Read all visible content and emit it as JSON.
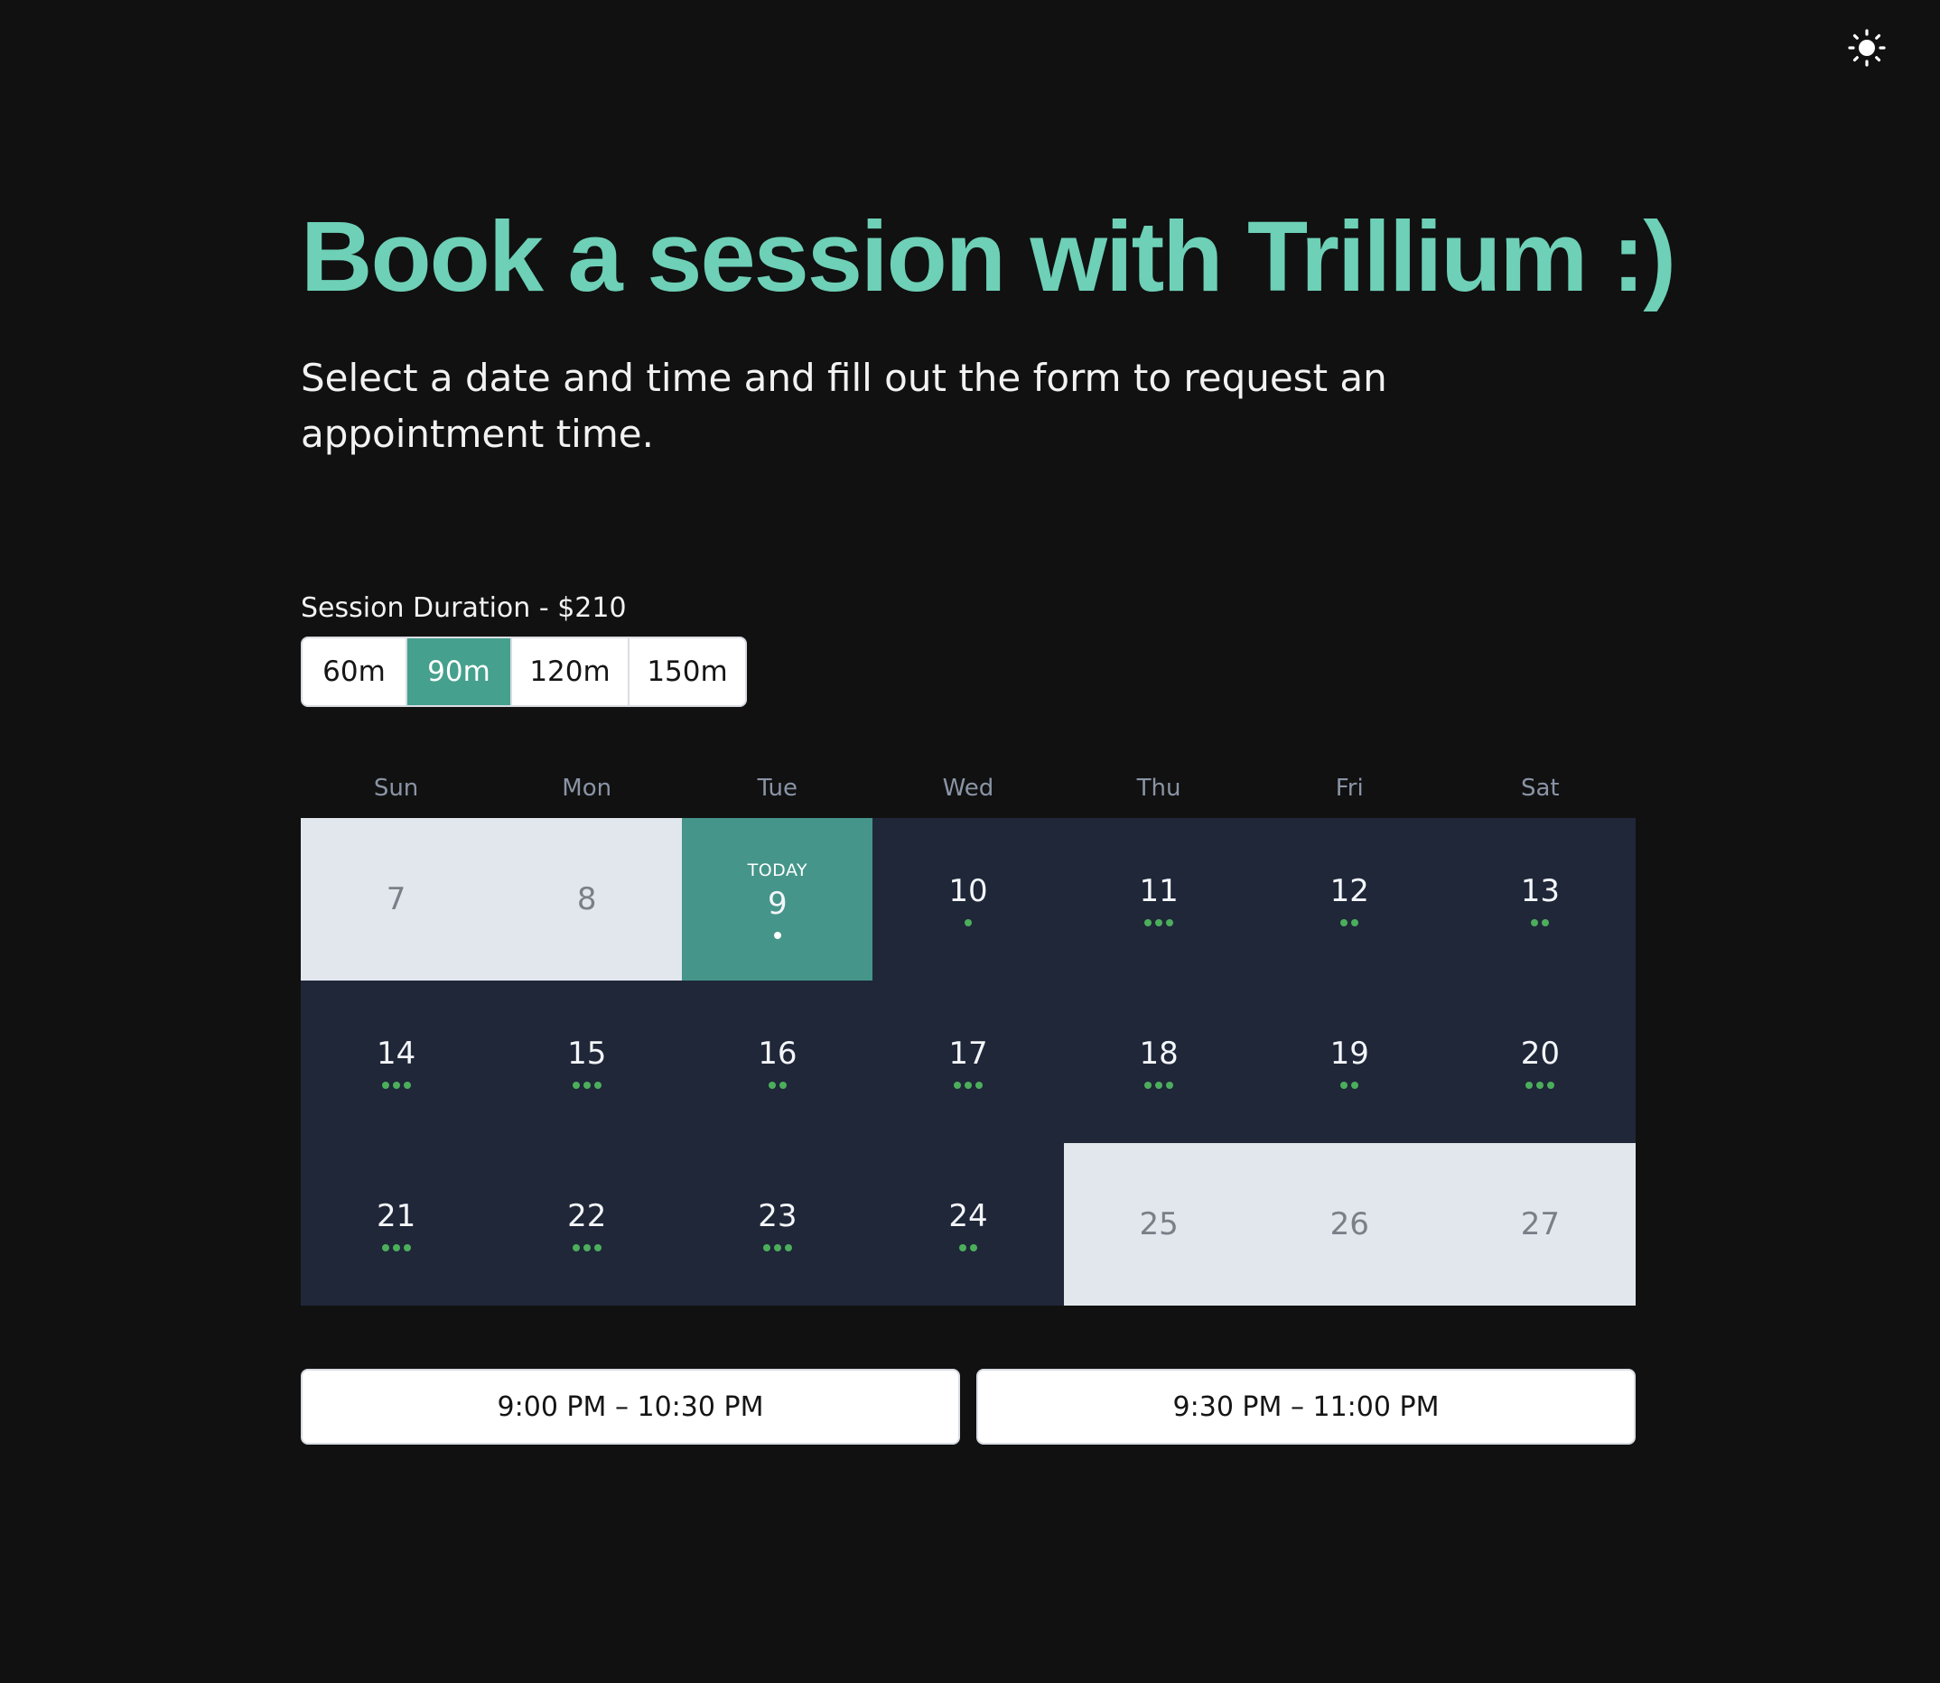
{
  "header": {
    "theme_toggle_icon": "sun-icon"
  },
  "hero": {
    "title": "Book a session with Trillium :)",
    "subtitle": "Select a date and time and fill out the form to request an appointment time."
  },
  "duration": {
    "label": "Session Duration - $210",
    "options": [
      "60m",
      "90m",
      "120m",
      "150m"
    ],
    "selected": "90m"
  },
  "calendar": {
    "weekdays": [
      "Sun",
      "Mon",
      "Tue",
      "Wed",
      "Thu",
      "Fri",
      "Sat"
    ],
    "today_label": "TODAY",
    "days": [
      {
        "num": "7",
        "state": "disabled",
        "slots": 0
      },
      {
        "num": "8",
        "state": "disabled",
        "slots": 0
      },
      {
        "num": "9",
        "state": "today",
        "slots": 1
      },
      {
        "num": "10",
        "state": "available",
        "slots": 1
      },
      {
        "num": "11",
        "state": "available",
        "slots": 3
      },
      {
        "num": "12",
        "state": "available",
        "slots": 2
      },
      {
        "num": "13",
        "state": "available",
        "slots": 2
      },
      {
        "num": "14",
        "state": "available",
        "slots": 3
      },
      {
        "num": "15",
        "state": "available",
        "slots": 3
      },
      {
        "num": "16",
        "state": "available",
        "slots": 2
      },
      {
        "num": "17",
        "state": "available",
        "slots": 3
      },
      {
        "num": "18",
        "state": "available",
        "slots": 3
      },
      {
        "num": "19",
        "state": "available",
        "slots": 2
      },
      {
        "num": "20",
        "state": "available",
        "slots": 3
      },
      {
        "num": "21",
        "state": "available",
        "slots": 3
      },
      {
        "num": "22",
        "state": "available",
        "slots": 3
      },
      {
        "num": "23",
        "state": "available",
        "slots": 3
      },
      {
        "num": "24",
        "state": "available",
        "slots": 2
      },
      {
        "num": "25",
        "state": "disabled",
        "slots": 0
      },
      {
        "num": "26",
        "state": "disabled",
        "slots": 0
      },
      {
        "num": "27",
        "state": "disabled",
        "slots": 0
      }
    ]
  },
  "time_slots": [
    "9:00 PM – 10:30 PM",
    "9:30 PM – 11:00 PM"
  ],
  "colors": {
    "background": "#111111",
    "accent": "#6dd0b7",
    "selected": "#45a08d",
    "day_available": "#1f2739",
    "day_disabled": "#e2e6ed",
    "slot_dot": "#4cae5b"
  }
}
